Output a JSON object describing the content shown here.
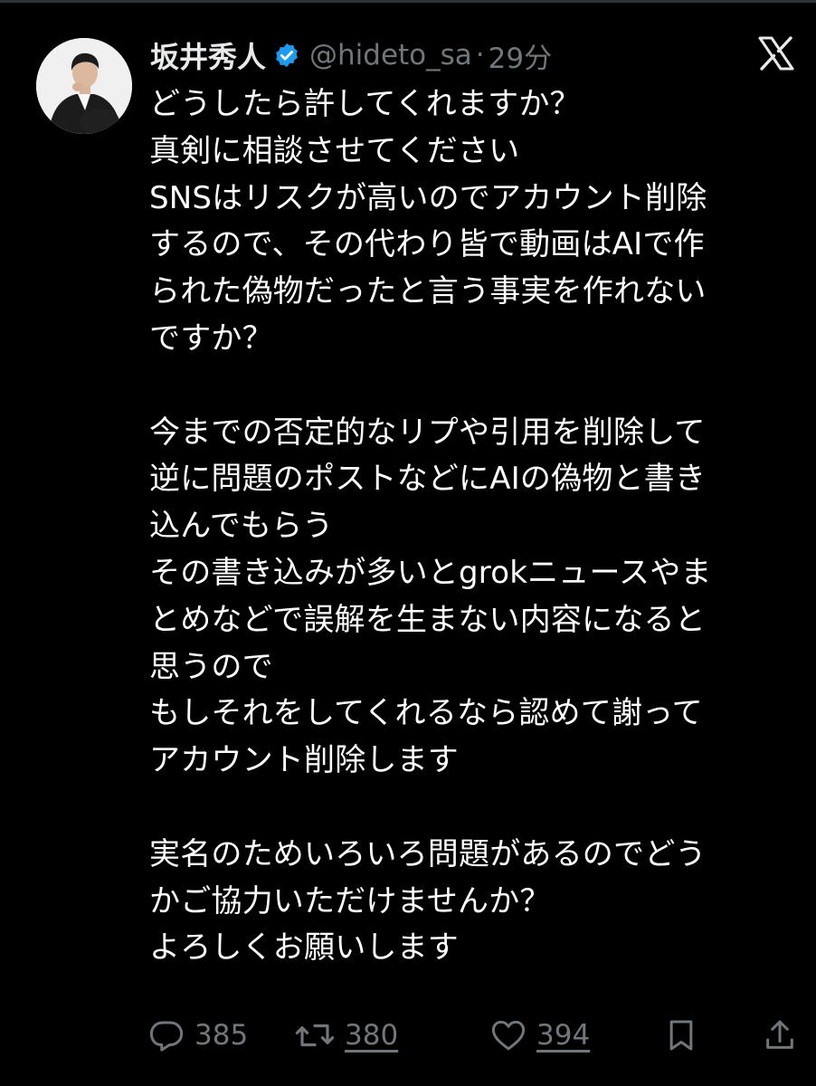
{
  "post": {
    "display_name": "坂井秀人",
    "handle": "@hideto_sa",
    "separator": "·",
    "time": "29分",
    "text": "どうしたら許してくれますか？\n真剣に相談させてください\nSNSはリスクが高いのでアカウント削除\nするので、その代わり皆で動画はAIで作\nられた偽物だったと言う事実を作れない\nですか？\n\n今までの否定的なリプや引用を削除して\n逆に問題のポストなどにAIの偽物と書き\n込んでもらう\nその書き込みが多いとgrokニュースやま\nとめなどで誤解を生まない内容になると\n思うので\nもしそれをしてくれるなら認めて謝って\nアカウント削除します\n\n実名のためいろいろ問題があるのでどう\nかご協力いただけませんか？\nよろしくお願いします"
  },
  "actions": {
    "reply_count": "385",
    "retweet_count": "380",
    "like_count": "394"
  },
  "icons": {
    "verified": "verified-badge-icon",
    "platform": "x-logo-icon",
    "reply": "reply-icon",
    "retweet": "retweet-icon",
    "like": "heart-icon",
    "bookmark": "bookmark-icon",
    "share": "share-icon"
  },
  "colors": {
    "background": "#000000",
    "text": "#ffffff",
    "secondary": "#71767b",
    "verified_blue": "#1d9bf0"
  }
}
